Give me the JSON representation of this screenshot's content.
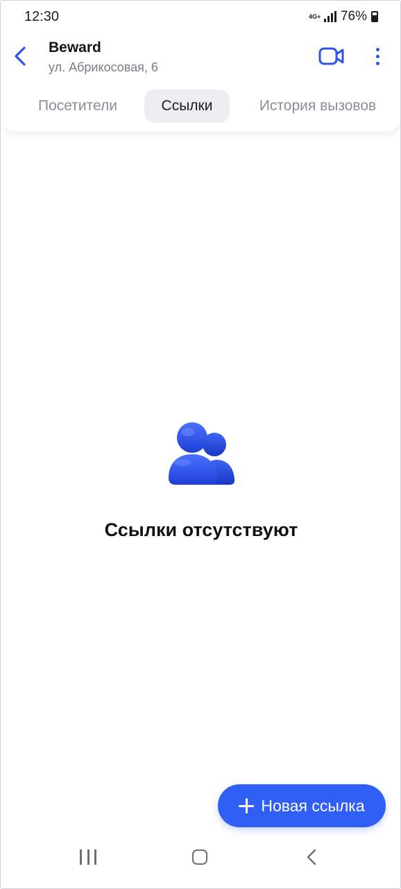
{
  "status_bar": {
    "time": "12:30",
    "network": "4G+",
    "battery": "76%"
  },
  "header": {
    "title": "Beward",
    "subtitle": "ул. Абрикосовая, 6",
    "back_icon": "chevron-left-icon",
    "video_icon": "video-camera-icon",
    "more_icon": "more-vertical-icon",
    "accent_color": "#2a54e8"
  },
  "tabs": [
    {
      "label": "Посетители",
      "selected": false
    },
    {
      "label": "Ссылки",
      "selected": true
    },
    {
      "label": "История вызовов",
      "selected": false
    }
  ],
  "empty_state": {
    "icon": "users-icon",
    "message": "Ссылки отсутствуют"
  },
  "fab": {
    "label": "Новая ссылка",
    "icon": "plus-icon",
    "color": "#2f5ff5"
  },
  "nav_bar": {
    "recent_icon": "recent-apps-icon",
    "home_icon": "home-icon",
    "back_icon": "back-icon"
  }
}
